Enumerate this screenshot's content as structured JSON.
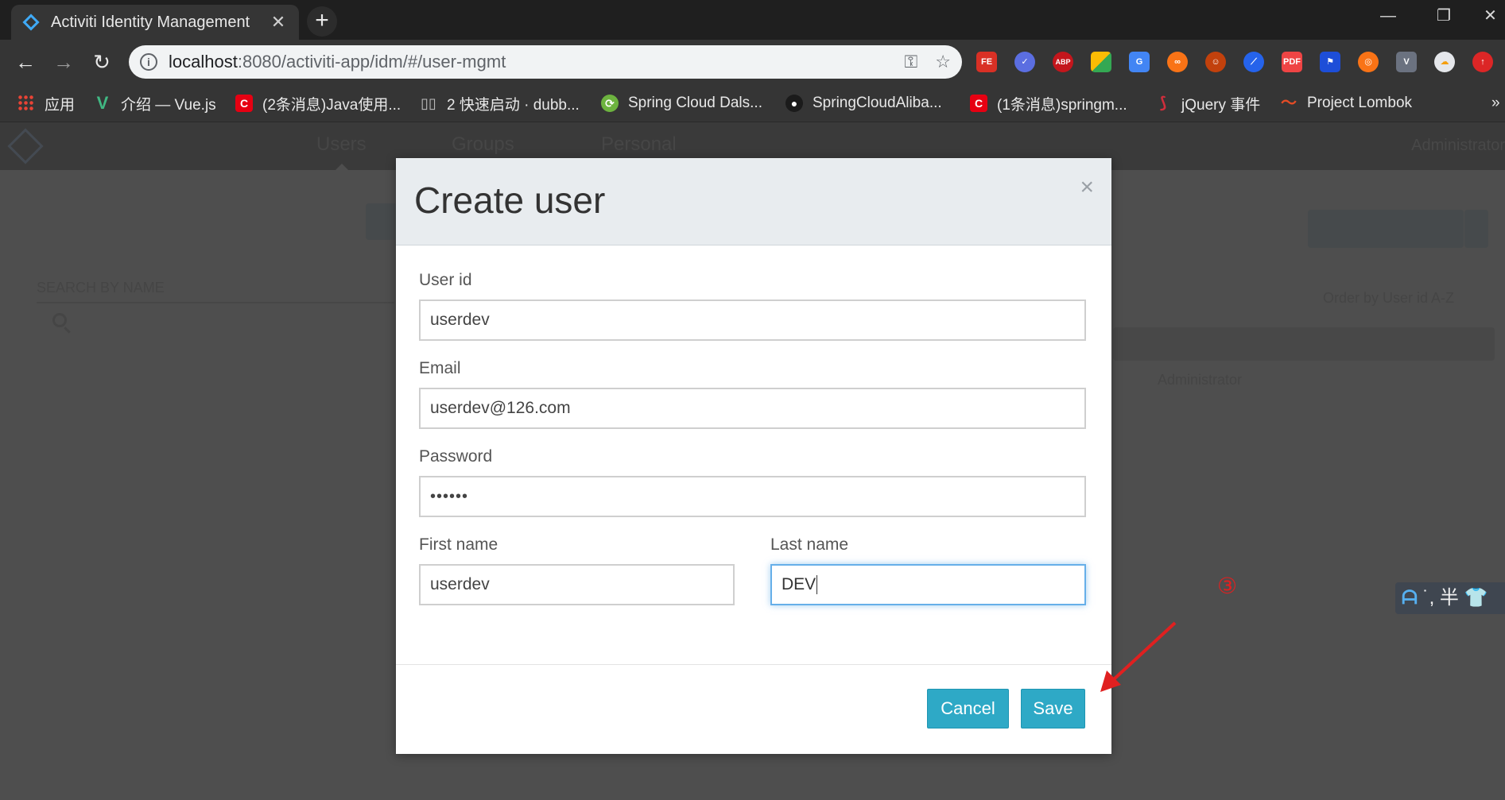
{
  "browser": {
    "tab_title": "Activiti Identity Management",
    "url_host": "localhost",
    "url_rest": ":8080/activiti-app/idm/#/user-mgmt",
    "bookmarks": [
      {
        "label": "应用",
        "icon": "apps-grid-icon",
        "color": "#e8c33a"
      },
      {
        "label": "介绍 — Vue.js",
        "icon": "vue-icon",
        "color": "#41b883"
      },
      {
        "label": "(2条消息)Java使用...",
        "icon": "csdn-icon",
        "color": "#e60012"
      },
      {
        "label": "2 快速启动 · dubb...",
        "icon": "book-icon",
        "color": "#9aa0a6"
      },
      {
        "label": "Spring Cloud Dals...",
        "icon": "spring-icon",
        "color": "#6db33f"
      },
      {
        "label": "SpringCloudAliba...",
        "icon": "github-icon",
        "color": "#222222"
      },
      {
        "label": "(1条消息)springm...",
        "icon": "csdn-icon",
        "color": "#e60012"
      },
      {
        "label": "jQuery 事件",
        "icon": "runoob-icon",
        "color": "#d02e3c"
      },
      {
        "label": "Project Lombok",
        "icon": "lombok-icon",
        "color": "#e34c26"
      }
    ],
    "bookmarks_more": "»"
  },
  "app": {
    "nav": [
      "Users",
      "Groups",
      "Personal"
    ],
    "admin": "Administrator",
    "search_label": "SEARCH BY NAME",
    "order_by": "Order by User id  A-Z",
    "user_row_name": "Administrator"
  },
  "modal": {
    "title": "Create user",
    "close": "×",
    "user_id_label": "User id",
    "user_id_value": "userdev",
    "email_label": "Email",
    "email_value": "userdev@126.com",
    "password_label": "Password",
    "password_value": "••••••",
    "first_name_label": "First name",
    "first_name_value": "userdev",
    "last_name_label": "Last name",
    "last_name_value": "DEV",
    "cancel_label": "Cancel",
    "save_label": "Save"
  },
  "annotation": {
    "step_number": "③",
    "ime_text": "˙, 半"
  },
  "colors": {
    "primary_button": "#2ea9c6",
    "annotation_red": "#e02020",
    "focus_border": "#66afe9"
  }
}
